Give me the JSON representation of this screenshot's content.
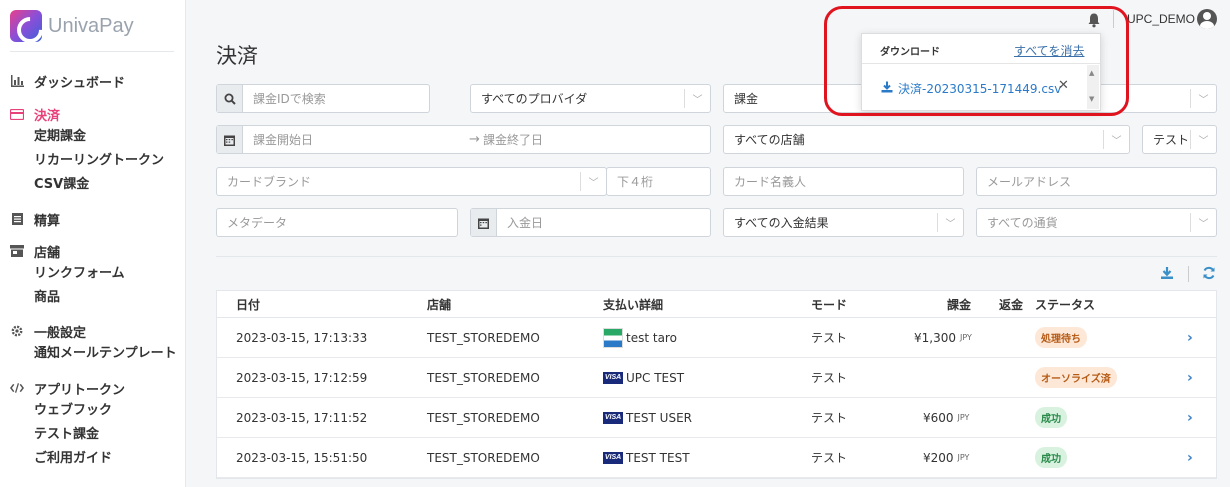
{
  "brand": {
    "name": "UnivaPay"
  },
  "topbar": {
    "username": "UPC_DEMO"
  },
  "sidebar": {
    "sections": [
      {
        "label": "ダッシュボード",
        "icon": "chart-icon",
        "active": false,
        "items": []
      },
      {
        "label": "決済",
        "icon": "card-icon",
        "active": true,
        "items": [
          "定期課金",
          "リカーリングトークン",
          "CSV課金"
        ]
      },
      {
        "label": "精算",
        "icon": "list-icon",
        "active": false,
        "items": []
      },
      {
        "label": "店舗",
        "icon": "store-icon",
        "active": false,
        "items": [
          "リンクフォーム",
          "商品"
        ]
      },
      {
        "label": "一般設定",
        "icon": "gear-icon",
        "active": false,
        "items": [
          "通知メールテンプレート"
        ]
      },
      {
        "label": "アプリトークン",
        "icon": "code-icon",
        "active": false,
        "items": [
          "ウェブフック",
          "テスト課金",
          "ご利用ガイド"
        ]
      }
    ]
  },
  "page": {
    "title": "決済"
  },
  "filters": {
    "search_placeholder": "課金IDで検索",
    "provider": "すべてのプロバイダ",
    "charge_type": "課金",
    "start_date_placeholder": "課金開始日",
    "end_date_placeholder": "課金終了日",
    "store": "すべての店舗",
    "mode": "テスト",
    "card_brand_placeholder": "カードブランド",
    "last4_placeholder": "下４桁",
    "cardholder_placeholder": "カード名義人",
    "email_placeholder": "メールアドレス",
    "metadata_placeholder": "メタデータ",
    "deposit_date_placeholder": "入金日",
    "deposit_result": "すべての入金結果",
    "currency_placeholder": "すべての通貨"
  },
  "table": {
    "headers": {
      "date": "日付",
      "store": "店舗",
      "payment": "支払い詳細",
      "mode": "モード",
      "amount": "課金",
      "refund": "返金",
      "status": "ステータス"
    },
    "rows": [
      {
        "date": "2023-03-15, 17:13:33",
        "store": "TEST_STOREDEMO",
        "card": "bank",
        "holder": "test taro",
        "mode": "テスト",
        "amount": "¥1,300",
        "currency": "JPY",
        "status": "処理待ち",
        "status_kind": "pending"
      },
      {
        "date": "2023-03-15, 17:12:59",
        "store": "TEST_STOREDEMO",
        "card": "visa",
        "holder": "UPC TEST",
        "mode": "テスト",
        "amount": "",
        "currency": "",
        "status": "オーソライズ済",
        "status_kind": "auth"
      },
      {
        "date": "2023-03-15, 17:11:52",
        "store": "TEST_STOREDEMO",
        "card": "visa",
        "holder": "TEST USER",
        "mode": "テスト",
        "amount": "¥600",
        "currency": "JPY",
        "status": "成功",
        "status_kind": "ok"
      },
      {
        "date": "2023-03-15, 15:51:50",
        "store": "TEST_STOREDEMO",
        "card": "visa",
        "holder": "TEST TEST",
        "mode": "テスト",
        "amount": "¥200",
        "currency": "JPY",
        "status": "成功",
        "status_kind": "ok"
      }
    ],
    "visa_label": "VISA"
  },
  "download_popup": {
    "title": "ダウンロード",
    "clear_all": "すべてを消去",
    "file": "決済-20230315-171449.csv",
    "close": "✕"
  },
  "colors": {
    "accent": "#e8407a",
    "link": "#2a7ac8",
    "highlight": "#e0141e"
  }
}
